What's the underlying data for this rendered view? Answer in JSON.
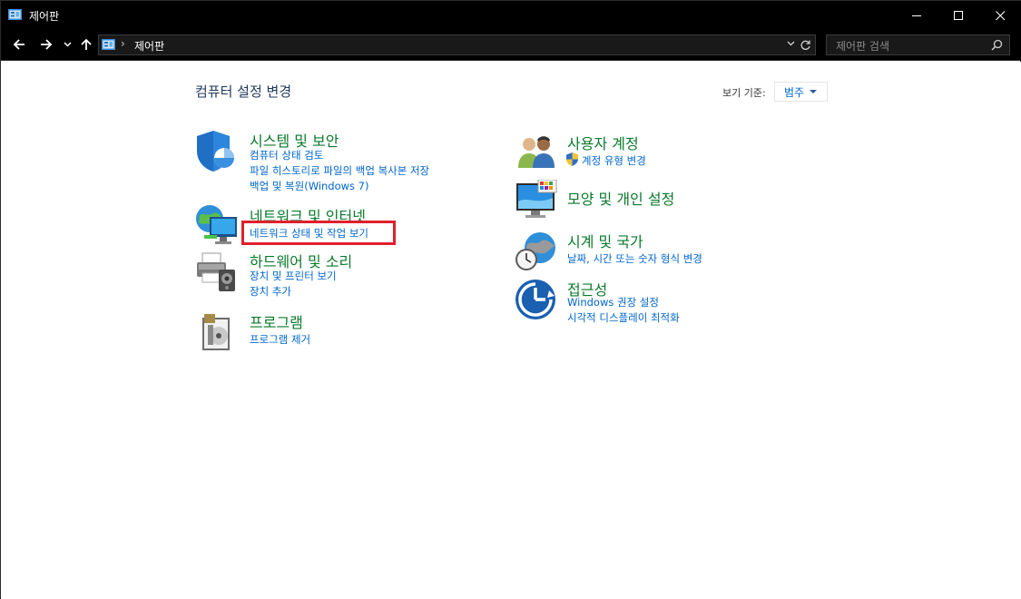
{
  "window": {
    "title": "제어판"
  },
  "address": {
    "path": "제어판",
    "separator": "›",
    "search_placeholder": "제어판 검색"
  },
  "page": {
    "title": "컴퓨터 설정 변경",
    "view_by_label": "보기 기준:",
    "view_by_value": "범주"
  },
  "categories": {
    "system": {
      "title": "시스템 및 보안",
      "links": [
        "컴퓨터 상태 검토",
        "파일 히스토리로 파일의 백업 복사본 저장",
        "백업 및 복원(Windows 7)"
      ]
    },
    "network": {
      "title": "네트워크 및 인터넷",
      "links": [
        "네트워크 상태 및 작업 보기"
      ]
    },
    "hardware": {
      "title": "하드웨어 및 소리",
      "links": [
        "장치 및 프린터 보기",
        "장치 추가"
      ]
    },
    "programs": {
      "title": "프로그램",
      "links": [
        "프로그램 제거"
      ]
    },
    "accounts": {
      "title": "사용자 계정",
      "links": [
        "계정 유형 변경"
      ]
    },
    "appearance": {
      "title": "모양 및 개인 설정",
      "links": []
    },
    "clock": {
      "title": "시계 및 국가",
      "links": [
        "날짜, 시간 또는 숫자 형식 변경"
      ]
    },
    "access": {
      "title": "접근성",
      "links": [
        "Windows 권장 설정",
        "시각적 디스플레이 최적화"
      ]
    }
  },
  "icons": {
    "app": "control-panel-icon",
    "back": "arrow-left-icon",
    "forward": "arrow-right-icon",
    "recent": "chevron-down-icon",
    "up": "arrow-up-icon",
    "refresh": "refresh-icon",
    "search": "search-icon"
  },
  "colors": {
    "category_title": "#0b7a2b",
    "link": "#0066cc",
    "highlight": "#e0202c",
    "titlebar": "#000000"
  }
}
